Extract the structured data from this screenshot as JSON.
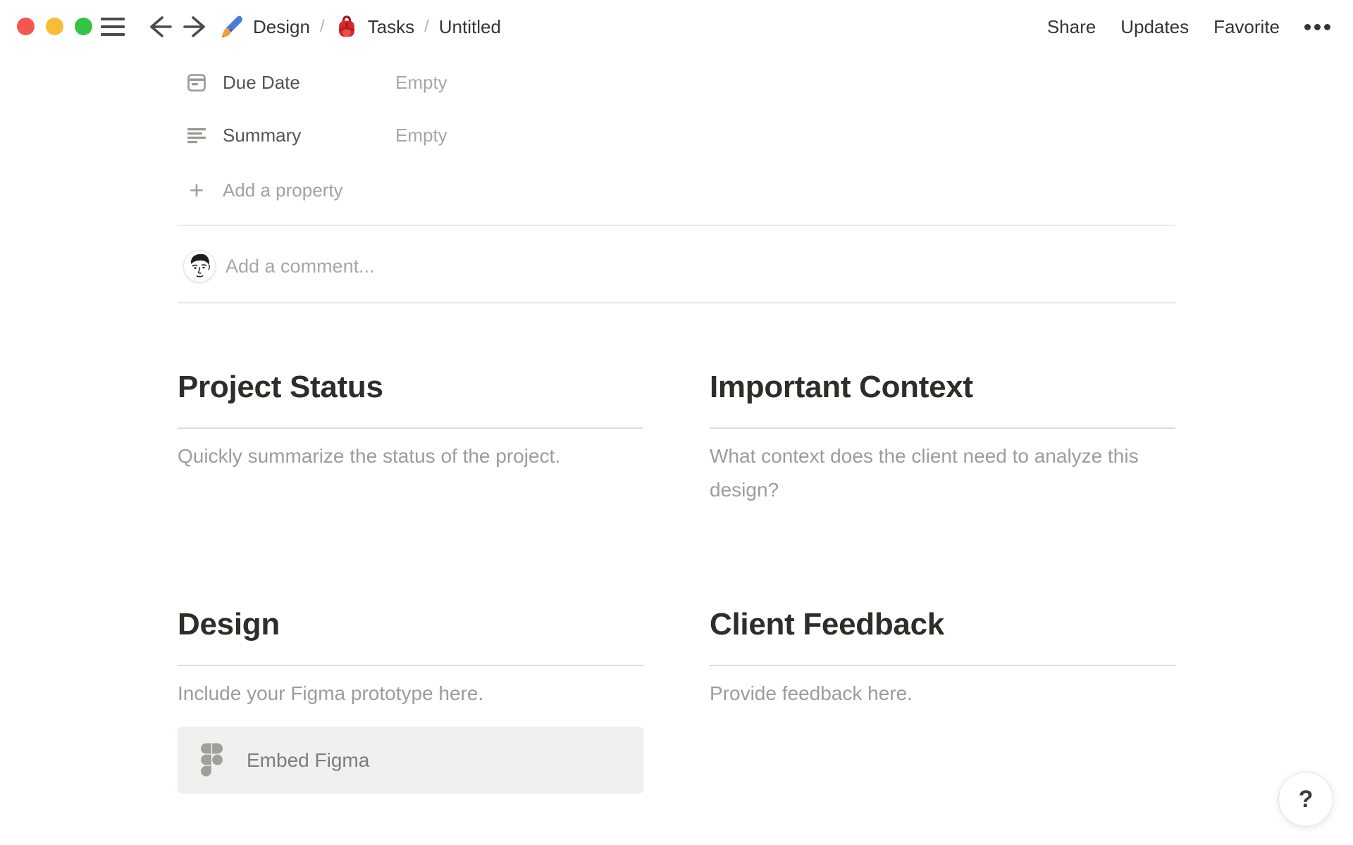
{
  "topbar": {
    "traffic_lights": {
      "close": "#f5564f",
      "minimize": "#f6bd35",
      "zoom": "#33c441"
    },
    "breadcrumb": [
      {
        "icon": "paintbrush-emoji",
        "label": "Design"
      },
      {
        "icon": "backpack-emoji",
        "label": "Tasks"
      },
      {
        "icon": "",
        "label": "Untitled"
      }
    ],
    "separator": "/",
    "actions": {
      "share": "Share",
      "updates": "Updates",
      "favorite": "Favorite"
    },
    "more_icon": "ellipsis-dots"
  },
  "properties": {
    "rows": [
      {
        "icon": "calendar-icon",
        "label": "Due Date",
        "value": "Empty"
      },
      {
        "icon": "text-summary-icon",
        "label": "Summary",
        "value": "Empty"
      }
    ],
    "add_glyph": "+",
    "add_label": "Add a property"
  },
  "comment": {
    "avatar": "user-avatar-sketch",
    "placeholder": "Add a comment..."
  },
  "sections": [
    {
      "title": "Project Status",
      "body": "Quickly summarize the status of the project."
    },
    {
      "title": "Important Context",
      "body": "What context does the client need to analyze this design?"
    },
    {
      "title": "Design",
      "body": "Include your Figma prototype here.",
      "embed_icon": "figma-logo-icon",
      "embed_label": "Embed Figma"
    },
    {
      "title": "Client Feedback",
      "body": "Provide feedback here."
    }
  ],
  "help": {
    "glyph": "?"
  },
  "colors": {
    "heading_text": "#2f2d28",
    "body_placeholder": "#9e9c99",
    "property_label": "#56544f",
    "property_empty": "#a9a7a4",
    "divider": "#eceae8",
    "heading_divider": "#dedcd9",
    "embed_button_bg": "#f1f0ee",
    "figma_icon_gray": "#a19f9a"
  }
}
